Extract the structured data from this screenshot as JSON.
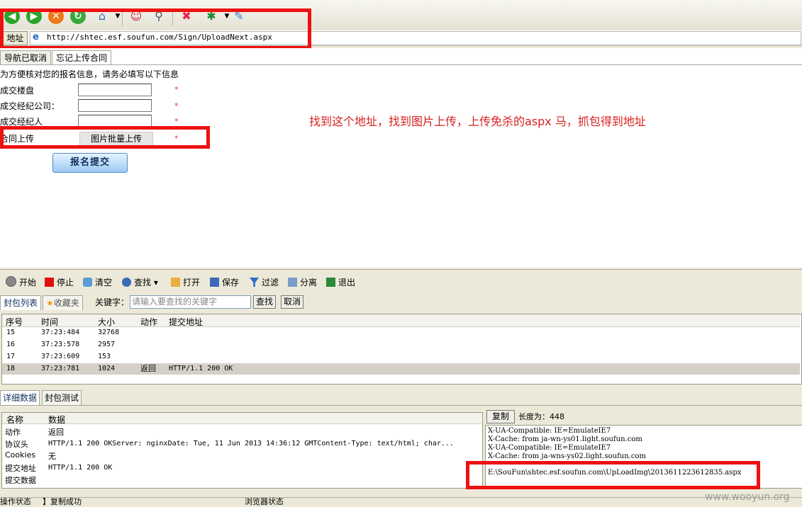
{
  "toolbar": {
    "icons": [
      "back-icon",
      "forward-icon",
      "stop-icon",
      "refresh-icon",
      "home-icon",
      "mascot-icon",
      "search-icon",
      "tools-icon",
      "settings-icon",
      "pin-icon"
    ]
  },
  "address": {
    "label": "地址",
    "url": "http://shtec.esf.soufun.com/Sign/UploadNext.aspx"
  },
  "page": {
    "tabs": [
      "导航已取消",
      "忘记上传合同"
    ],
    "intro": "为方便核对您的报名信息，请务必填写以下信息",
    "fields": [
      {
        "label": "成交楼盘",
        "required": "*"
      },
      {
        "label": "成交经纪公司：",
        "required": "*"
      },
      {
        "label": "成交经纪人",
        "required": "*"
      }
    ],
    "upload": {
      "label": "合同上传",
      "button": "图片批量上传",
      "required": "*"
    },
    "submit": "报名提交",
    "annotation": "找到这个地址，找到图片上传，上传免杀的aspx 马，抓包得到地址"
  },
  "sniffer": {
    "toolbar": [
      "开始",
      "停止",
      "清空",
      "查找",
      "打开",
      "保存",
      "过滤",
      "分离",
      "退出"
    ],
    "tabs": [
      "封包列表",
      "收藏夹"
    ],
    "keyword_label": "关键字：",
    "keyword_placeholder": "请输入要查找的关键字",
    "find_button": "查找",
    "cancel_button": "取消",
    "columns": [
      "序号",
      "时间",
      "大小",
      "动作",
      "提交地址"
    ],
    "rows": [
      {
        "id": "15",
        "time": "37:23:484",
        "size": "32768",
        "action": "",
        "url": ""
      },
      {
        "id": "16",
        "time": "37:23:578",
        "size": "2957",
        "action": "",
        "url": ""
      },
      {
        "id": "17",
        "time": "37:23:609",
        "size": "153",
        "action": "",
        "url": ""
      },
      {
        "id": "18",
        "time": "37:23:781",
        "size": "1024",
        "action": "返回",
        "url": "HTTP/1.1 200 OK"
      }
    ],
    "detail_tabs": [
      "详细数据",
      "封包测试"
    ],
    "detail_columns": [
      "名称",
      "数据"
    ],
    "details": [
      {
        "name": "动作",
        "value": "返回"
      },
      {
        "name": "协议头",
        "value": "HTTP/1.1 200 OKServer: nginxDate: Tue, 11 Jun 2013 14:36:12 GMTContent-Type: text/html; char..."
      },
      {
        "name": "Cookies",
        "value": "无"
      },
      {
        "name": "提交地址",
        "value": "HTTP/1.1 200 OK"
      },
      {
        "name": "提交数据",
        "value": ""
      }
    ],
    "copy_button": "复制",
    "length_label": "长度为：448",
    "raw_lines": [
      "X-UA-Compatible: IE=EmulateIE7",
      "X-Cache: from ja-wn-ys01.light.soufun.com",
      "X-UA-Compatible: IE=EmulateIE7",
      "X-Cache:  from ja-wns-ys02.light.soufun.com",
      "E:\\SouFun\\shtec.esf.soufun.com\\UpLoadImg\\2013611223612835.aspx"
    ]
  },
  "status": {
    "left": "操作状态",
    "middle": "】复制成功",
    "right": "浏览器状态"
  },
  "watermark": "www.wooyun.org",
  "colors": {
    "highlight_box": "#ee1111",
    "annotation": "#d8201f"
  }
}
